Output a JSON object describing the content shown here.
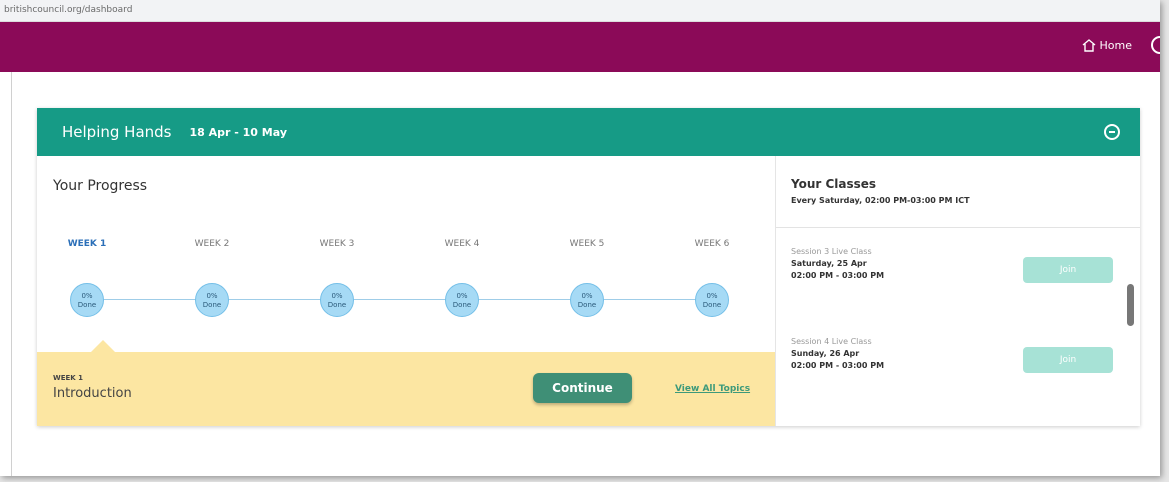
{
  "browser": {
    "url": "britishcouncil.org/dashboard"
  },
  "topbar": {
    "home_label": "Home",
    "background_color": "#8b0a58"
  },
  "course": {
    "title": "Helping Hands",
    "dates": "18 Apr - 10 May",
    "header_color": "#169b86"
  },
  "progress": {
    "title": "Your Progress",
    "weeks": [
      {
        "label": "WEEK 1",
        "done": "0%",
        "done_word": "Done",
        "active": true
      },
      {
        "label": "WEEK 2",
        "done": "0%",
        "done_word": "Done",
        "active": false
      },
      {
        "label": "WEEK 3",
        "done": "0%",
        "done_word": "Done",
        "active": false
      },
      {
        "label": "WEEK 4",
        "done": "0%",
        "done_word": "Done",
        "active": false
      },
      {
        "label": "WEEK 5",
        "done": "0%",
        "done_word": "Done",
        "active": false
      },
      {
        "label": "WEEK 6",
        "done": "0%",
        "done_word": "Done",
        "active": false
      }
    ],
    "current": {
      "week": "WEEK 1",
      "topic": "Introduction",
      "continue_label": "Continue",
      "view_all_label": "View All Topics"
    }
  },
  "classes": {
    "title": "Your Classes",
    "schedule": "Every Saturday, 02:00 PM-03:00 PM ICT",
    "sessions": [
      {
        "name": "Session 3 Live Class",
        "date": "Saturday, 25 Apr",
        "time": "02:00 PM - 03:00 PM",
        "join_label": "Join"
      },
      {
        "name": "Session 4 Live Class",
        "date": "Sunday, 26 Apr",
        "time": "02:00 PM - 03:00 PM",
        "join_label": "Join"
      }
    ]
  },
  "icons": [
    "home-icon",
    "collapse-minus-icon",
    "scrollbar-thumb"
  ]
}
